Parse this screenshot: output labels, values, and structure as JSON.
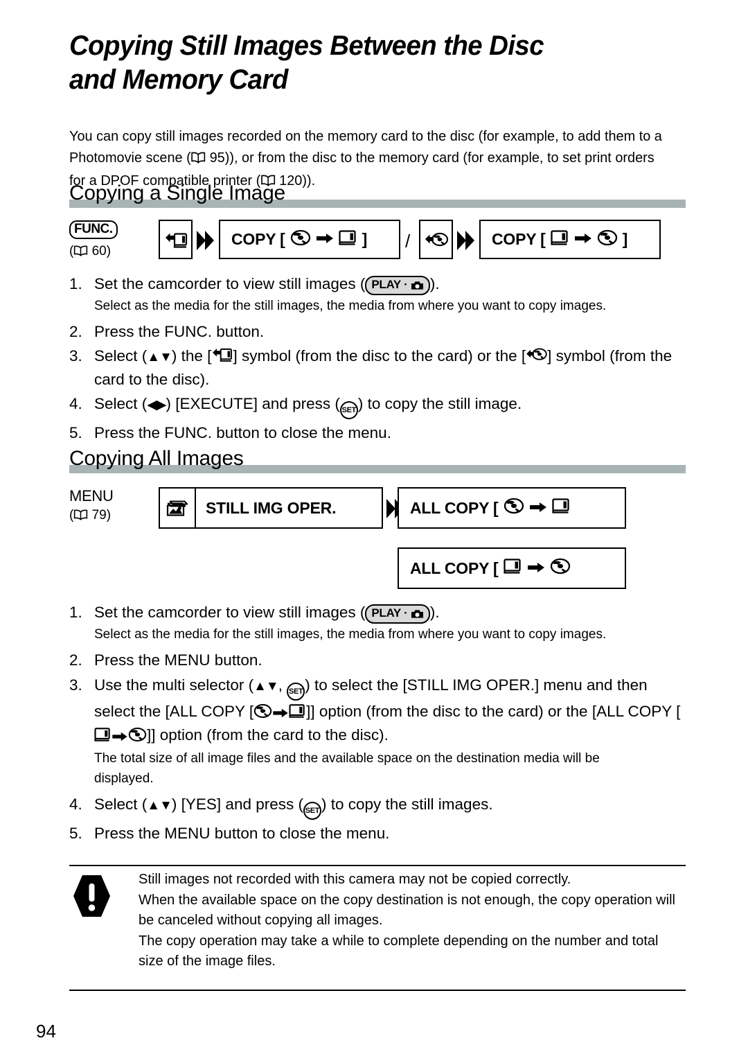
{
  "document": {
    "title": "Copying Still Images Between the Disc and Memory Card",
    "page_number": "94",
    "intro": "You can copy still images recorded on the memory card to the disc (for example, to add them to a Photomovie scene ( 95)), or from the disc to the memory card (for example, to set print orders for a DPOF compatible printer ( 120))."
  },
  "sections": [
    {
      "heading": "Copying a Single Image",
      "flow": {
        "entry_label": "FUNC.",
        "entry_page_ref": "60",
        "boxes": [
          {
            "icon": "disc-to-card-icon",
            "text": "COPY [",
            "from": "disc-icon",
            "to": "card-icon",
            "close": "]"
          },
          {
            "icon": "card-to-disc-icon",
            "text": "COPY [",
            "from": "card-icon",
            "to": "disc-icon",
            "close": "]"
          }
        ],
        "separator": "/"
      },
      "steps": [
        {
          "num": "1.",
          "text_before": "Set the camcorder to view still images (",
          "badge": "PLAY",
          "text_after": ").",
          "sub": "Select as the media for the still images, the media from where you want to copy images."
        },
        {
          "num": "2.",
          "text": "Press the FUNC. button."
        },
        {
          "num": "3.",
          "parts": [
            "Select (",
            "▲▼",
            ") the [",
            "disc-to-card-icon",
            "] symbol (from the disc to the card) or the [",
            "card-to-disc-icon",
            "] symbol (from the card to the disc)."
          ]
        },
        {
          "num": "4.",
          "parts": [
            "Select (",
            "◀▶",
            ") [EXECUTE] and press (",
            "SET",
            ") to copy the still image."
          ]
        },
        {
          "num": "5.",
          "text": "Press the FUNC. button to close the menu."
        }
      ]
    },
    {
      "heading": "Copying All Images",
      "flow": {
        "entry_label": "MENU",
        "entry_page_ref": "79",
        "menu_box": {
          "icon": "still-images-icon",
          "text": "STILL IMG OPER."
        },
        "option_boxes": [
          {
            "text": "ALL COPY [",
            "from": "disc-icon",
            "to": "card-icon"
          },
          {
            "text": "ALL COPY [",
            "from": "card-icon",
            "to": "disc-icon"
          }
        ]
      },
      "steps": [
        {
          "num": "1.",
          "text_before": "Set the camcorder to view still images (",
          "badge": "PLAY",
          "text_after": ").",
          "sub": "Select as the media for the still images, the media from where you want to copy images."
        },
        {
          "num": "2.",
          "text": "Press the MENU button."
        },
        {
          "num": "3.",
          "parts": [
            "Use the multi selector (",
            "▲▼",
            ", ",
            "SET",
            ") to select the [STILL IMG OPER.] menu and then select the [ALL COPY [",
            "disc-icon",
            " ➔ ",
            "card-icon",
            "]] option (from the disc to the card) or the [ALL COPY [",
            "card-icon",
            " ➔ ",
            "disc-icon",
            "]] option (from the card to the disc)."
          ],
          "sub": "The total size of all image files and the available space on the destination media will be displayed."
        },
        {
          "num": "4.",
          "parts": [
            "Select (",
            "▲▼",
            ") [YES] and press (",
            "SET",
            ") to copy the still images."
          ]
        },
        {
          "num": "5.",
          "text": "Press the MENU button to close the menu."
        }
      ]
    }
  ],
  "note": {
    "icon": "caution-icon",
    "lines": [
      "Still images not recorded with this camera may not be copied correctly.",
      "When the available space on the copy destination is not enough, the copy operation will be canceled without copying all images.",
      "The copy operation may take a while to complete depending on the number and total size of the image files."
    ]
  },
  "text_fragments": {
    "intro_a": "You can copy still images recorded on the memory card to the disc (for example, to add them to a Photomovie scene (",
    "intro_ref1": "95",
    "intro_b": ")), or from the disc to the memory card (for example, to set print orders for a DPOF compatible printer (",
    "intro_ref2": "120",
    "intro_c": ")).",
    "func_label": "FUNC.",
    "func_ref": "60",
    "menu_label": "MENU",
    "menu_ref": "79",
    "copy_label": "COPY [",
    "bracket_close": "]",
    "allcopy_label": "ALL COPY [",
    "still_img_oper": "STILL IMG OPER.",
    "slash": "/",
    "play_badge": "PLAY",
    "set_badge": "SET",
    "s1_step1_a": "Set the camcorder to view still images (",
    "s1_step1_b": ").",
    "s1_step1_sub": "Select as the media for the still images, the media from where you want to copy images.",
    "s1_step2": "Press the FUNC. button.",
    "s1_step3_a": "Select (",
    "s1_step3_b": ") the [",
    "s1_step3_c": "] symbol (from the disc to the card) or the [",
    "s1_step3_d": "] symbol (from the card to the disc).",
    "s1_step4_a": "Select (",
    "s1_step4_b": ") [EXECUTE] and press (",
    "s1_step4_c": ") to copy the still image.",
    "s1_step5": "Press the FUNC. button to close the menu.",
    "s2_step1_sub": "Select as the media for the still images, the media from where you want to copy images.",
    "s2_step2": "Press the MENU button.",
    "s2_step3_a": "Use the multi selector (",
    "s2_step3_b": ", ",
    "s2_step3_c": ") to select the [STILL IMG OPER.] menu and then select the [ALL COPY [",
    "s2_step3_d": "]] option (from the disc to the card) or the [ALL COPY [",
    "s2_step3_e": "]] option (from the card to the disc).",
    "s2_step3_sub": "The total size of all image files and the available space on the destination media will be displayed.",
    "s2_step4_a": "Select (",
    "s2_step4_b": ") [YES] and press (",
    "s2_step4_c": ") to copy the still images.",
    "s2_step5": "Press the MENU button to close the menu.",
    "up_down": "▲▼",
    "left_right": "◀▶",
    "note1": "Still images not recorded with this camera may not be copied correctly.",
    "note2": "When the available space on the copy destination is not enough, the copy operation will be canceled without copying all images.",
    "note3": "The copy operation may take a while to complete depending on the number and total size of the image files.",
    "folio": "94",
    "heading1": "Copying a Single Image",
    "heading2": "Copying All Images",
    "title_line1": "Copying Still Images Between the Disc",
    "title_line2": "and Memory Card"
  },
  "colors": {
    "heading_rule": "#a8b4b3",
    "badge_fill": "#d9d9d9",
    "ink": "#000000",
    "paper": "#ffffff"
  }
}
